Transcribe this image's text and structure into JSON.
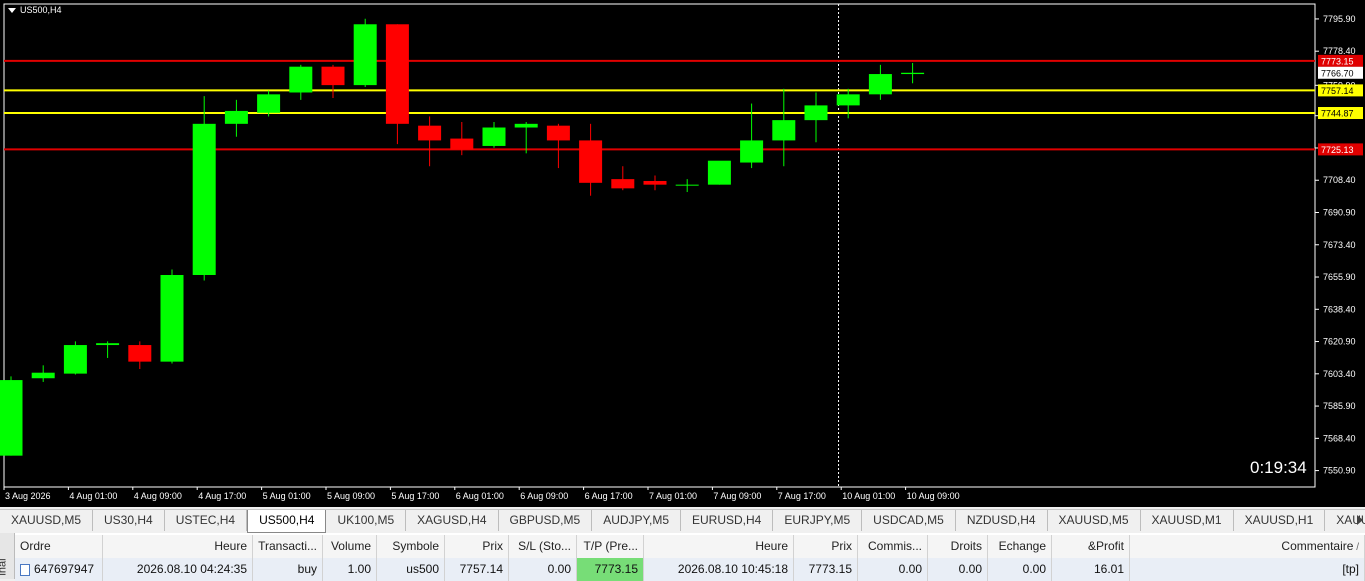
{
  "chart": {
    "symbol_label": "US500,H4",
    "timer": "0:19:34",
    "colors": {
      "bull": "#00ff00",
      "bear": "#ff0000",
      "background": "#000000",
      "axis_text": "#ffffff",
      "red_line": "#e00000",
      "yellow_line": "#ffff00"
    }
  },
  "chart_data": {
    "type": "candlestick",
    "title": "US500,H4",
    "ylim": [
      7550.9,
      7804
    ],
    "y_ticks": [
      "7795.90",
      "7778.40",
      "7759.90",
      "7743.40",
      "7725.90",
      "7708.40",
      "7690.90",
      "7673.40",
      "7655.90",
      "7638.40",
      "7620.90",
      "7603.40",
      "7585.90",
      "7568.40",
      "7550.90"
    ],
    "x_ticks": [
      "3 Aug 2026",
      "4 Aug 01:00",
      "4 Aug 09:00",
      "4 Aug 17:00",
      "5 Aug 01:00",
      "5 Aug 09:00",
      "5 Aug 17:00",
      "6 Aug 01:00",
      "6 Aug 09:00",
      "6 Aug 17:00",
      "7 Aug 01:00",
      "7 Aug 09:00",
      "7 Aug 17:00",
      "10 Aug 01:00",
      "10 Aug 09:00"
    ],
    "candles": [
      {
        "o": 7559.0,
        "h": 7602.0,
        "l": 7559.0,
        "c": 7600.0
      },
      {
        "o": 7601.0,
        "h": 7608.0,
        "l": 7599.0,
        "c": 7604.0
      },
      {
        "o": 7603.5,
        "h": 7621.0,
        "l": 7603.0,
        "c": 7619.0
      },
      {
        "o": 7619.0,
        "h": 7621.0,
        "l": 7612.0,
        "c": 7620.0
      },
      {
        "o": 7619.0,
        "h": 7621.0,
        "l": 7606.0,
        "c": 7610.0
      },
      {
        "o": 7610.0,
        "h": 7660.0,
        "l": 7609.0,
        "c": 7657.0
      },
      {
        "o": 7657.0,
        "h": 7754.0,
        "l": 7654.0,
        "c": 7739.0
      },
      {
        "o": 7739.0,
        "h": 7752.0,
        "l": 7732.0,
        "c": 7746.0
      },
      {
        "o": 7745.0,
        "h": 7757.0,
        "l": 7743.0,
        "c": 7755.0
      },
      {
        "o": 7756.0,
        "h": 7771.0,
        "l": 7752.0,
        "c": 7770.0
      },
      {
        "o": 7770.0,
        "h": 7771.0,
        "l": 7753.0,
        "c": 7760.0
      },
      {
        "o": 7760.0,
        "h": 7796.0,
        "l": 7759.0,
        "c": 7793.0
      },
      {
        "o": 7793.0,
        "h": 7793.0,
        "l": 7728.0,
        "c": 7739.0
      },
      {
        "o": 7738.0,
        "h": 7743.0,
        "l": 7716.0,
        "c": 7730.0
      },
      {
        "o": 7731.0,
        "h": 7740.0,
        "l": 7722.0,
        "c": 7725.0
      },
      {
        "o": 7727.0,
        "h": 7740.0,
        "l": 7726.0,
        "c": 7737.0
      },
      {
        "o": 7737.0,
        "h": 7740.0,
        "l": 7723.0,
        "c": 7739.0
      },
      {
        "o": 7738.0,
        "h": 7739.0,
        "l": 7715.0,
        "c": 7730.0
      },
      {
        "o": 7730.0,
        "h": 7739.0,
        "l": 7700.0,
        "c": 7707.0
      },
      {
        "o": 7709.0,
        "h": 7716.0,
        "l": 7703.0,
        "c": 7704.0
      },
      {
        "o": 7708.0,
        "h": 7711.0,
        "l": 7703.0,
        "c": 7706.0
      },
      {
        "o": 7706.0,
        "h": 7709.0,
        "l": 7702.0,
        "c": 7706.0
      },
      {
        "o": 7706.0,
        "h": 7718.0,
        "l": 7706.0,
        "c": 7719.0
      },
      {
        "o": 7718.0,
        "h": 7750.0,
        "l": 7715.0,
        "c": 7730.0
      },
      {
        "o": 7730.0,
        "h": 7758.0,
        "l": 7716.0,
        "c": 7741.0
      },
      {
        "o": 7741.0,
        "h": 7756.0,
        "l": 7729.0,
        "c": 7749.0
      },
      {
        "o": 7749.0,
        "h": 7758.0,
        "l": 7742.0,
        "c": 7755.0
      },
      {
        "o": 7755.0,
        "h": 7771.0,
        "l": 7752.0,
        "c": 7766.0
      },
      {
        "o": 7766.0,
        "h": 7772.0,
        "l": 7761.0,
        "c": 7766.7
      }
    ],
    "price_lines": [
      {
        "price": 7773.15,
        "label": "7773.15",
        "color": "#e00000"
      },
      {
        "price": 7757.14,
        "label": "7757.14",
        "color": "#ffff00"
      },
      {
        "price": 7744.87,
        "label": "7744.87",
        "color": "#ffff00"
      },
      {
        "price": 7725.13,
        "label": "7725.13",
        "color": "#e00000"
      }
    ],
    "current_price_label": "7766.70",
    "cursor_vline_index": 25.7
  },
  "tabs": [
    "XAUUSD,M5",
    "US30,H4",
    "USTEC,H4",
    "US500,H4",
    "UK100,M5",
    "XAGUSD,H4",
    "GBPUSD,M5",
    "AUDJPY,M5",
    "EURUSD,H4",
    "EURJPY,M5",
    "USDCAD,M5",
    "NZDUSD,H4",
    "XAUUSD,M5",
    "XAUUSD,M1",
    "XAUUSD,H1",
    "XAUUSD,Week"
  ],
  "active_tab": "US500,H4",
  "terminal": {
    "side_label": "inal",
    "headers": [
      "Ordre",
      "Heure",
      "Transacti...",
      "Volume",
      "Symbole",
      "Prix",
      "S/L (Sto...",
      "T/P (Pre...",
      "Heure",
      "Prix",
      "Commis...",
      "Droits",
      "Echange",
      "&Profit",
      "Commentaire"
    ],
    "sort_indicator": "/",
    "row": [
      "647697947",
      "2026.08.10 04:24:35",
      "buy",
      "1.00",
      "us500",
      "7757.14",
      "0.00",
      "7773.15",
      "2026.08.10 10:45:18",
      "7773.15",
      "0.00",
      "0.00",
      "0.00",
      "16.01",
      "[tp]"
    ]
  }
}
